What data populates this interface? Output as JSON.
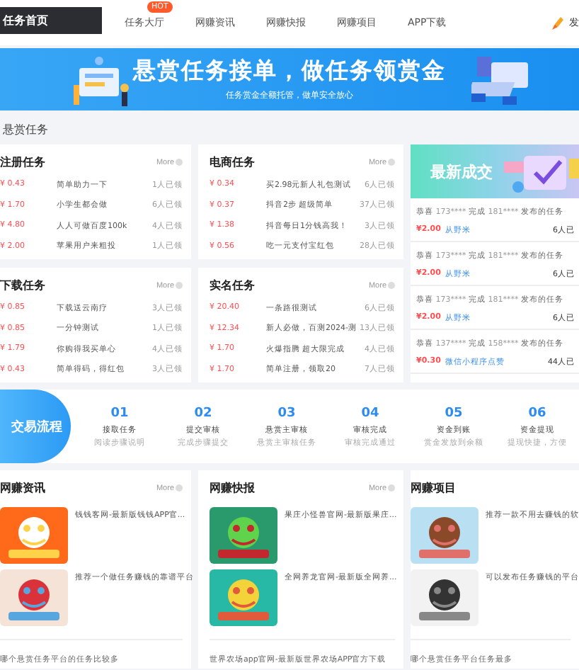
{
  "header": {
    "logo": "任务首页",
    "nav": [
      {
        "label": "任务大厅",
        "badge": "HOT",
        "selected": false
      },
      {
        "label": "网赚资讯",
        "selected": false
      },
      {
        "label": "网赚快报",
        "selected": false
      },
      {
        "label": "网赚项目",
        "selected": false
      },
      {
        "label": "APP下载",
        "selected": false
      }
    ],
    "right_text": "发"
  },
  "banner": {
    "title": "悬赏任务接单，做任务领赏金",
    "subtitle": "任务赏金全额托管，做单安全放心"
  },
  "section_title": "悬赏任务",
  "task_cards": [
    {
      "title": "注册任务",
      "more": "More",
      "rows": [
        {
          "price": "¥ 0.43",
          "name": "简单助力一下",
          "count": "1人已领"
        },
        {
          "price": "¥ 1.70",
          "name": "小学生都会做",
          "count": "6人已领"
        },
        {
          "price": "¥ 4.80",
          "name": "人人可做百度100k",
          "count": "4人已领"
        },
        {
          "price": "¥ 2.00",
          "name": "苹果用户来粗投",
          "count": "1人已领"
        }
      ]
    },
    {
      "title": "电商任务",
      "more": "More",
      "rows": [
        {
          "price": "¥ 0.34",
          "name": "买2.98元新人礼包测试",
          "count": "6人已领"
        },
        {
          "price": "¥ 0.37",
          "name": "抖音2步 超级简单",
          "count": "37人已领"
        },
        {
          "price": "¥ 1.38",
          "name": "抖音每日1分钱高我！",
          "count": "3人已领"
        },
        {
          "price": "¥ 0.56",
          "name": "吃一元支付宝红包",
          "count": "28人已领"
        }
      ]
    },
    {
      "title": "下载任务",
      "more": "More",
      "rows": [
        {
          "price": "¥ 0.85",
          "name": "下载送云南疗",
          "count": "3人已领"
        },
        {
          "price": "¥ 0.85",
          "name": "一分钟测试",
          "count": "1人已领"
        },
        {
          "price": "¥ 1.79",
          "name": "你购得我买单心",
          "count": "4人已领"
        },
        {
          "price": "¥ 0.43",
          "name": "简单得码，得红包",
          "count": "3人已领"
        }
      ]
    },
    {
      "title": "实名任务",
      "more": "More",
      "rows": [
        {
          "price": "¥ 20.40",
          "name": "一条路很测试",
          "count": "6人已领"
        },
        {
          "price": "¥ 12.34",
          "name": "新人必做，百测2024-测",
          "count": "13人已领"
        },
        {
          "price": "¥ 1.70",
          "name": "火爆指腾 超大限完成",
          "count": "4人已领"
        },
        {
          "price": "¥ 1.70",
          "name": "简单注册，领取20",
          "count": "7人已领"
        }
      ]
    }
  ],
  "deals": {
    "title": "最新成交",
    "items": [
      {
        "prefix": "恭喜",
        "user": "173****",
        "verb": "完成",
        "owner": "181****",
        "suffix": "发布的任务",
        "amount": "¥2.00",
        "task": "从野米",
        "earned": "6人已"
      },
      {
        "prefix": "恭喜",
        "user": "173****",
        "verb": "完成",
        "owner": "181****",
        "suffix": "发布的任务",
        "amount": "¥2.00",
        "task": "从野米",
        "earned": "6人已"
      },
      {
        "prefix": "恭喜",
        "user": "173****",
        "verb": "完成",
        "owner": "181****",
        "suffix": "发布的任务",
        "amount": "¥2.00",
        "task": "从野米",
        "earned": "6人已"
      },
      {
        "prefix": "恭喜",
        "user": "137****",
        "verb": "完成",
        "owner": "158****",
        "suffix": "发布的任务",
        "amount": "¥0.30",
        "task": "微信小程序点赞",
        "earned": "44人已"
      }
    ]
  },
  "process": {
    "title": "交易流程",
    "steps": [
      {
        "number": "01",
        "label": "接取任务",
        "note": "阅读步骤说明"
      },
      {
        "number": "02",
        "label": "提交审核",
        "note": "完成步骤提交"
      },
      {
        "number": "03",
        "label": "悬赏主审核",
        "note": "悬赏主审核任务"
      },
      {
        "number": "04",
        "label": "审核完成",
        "note": "审核完成通过"
      },
      {
        "number": "05",
        "label": "资金到账",
        "note": "赏金发放到余额"
      },
      {
        "number": "06",
        "label": "资金提现",
        "note": "提现快捷，方便"
      }
    ]
  },
  "news_cards": [
    {
      "title": "网赚资讯",
      "more": "More",
      "items": [
        {
          "text": "钱钱客网-最新版钱钱APP官..."
        },
        {
          "text": "推荐一个做任务赚钱的靠谱平台"
        }
      ],
      "footer": "哪个悬赏任务平台的任务比较多"
    },
    {
      "title": "网赚快报",
      "more": "More",
      "items": [
        {
          "text": "果庄小怪兽官网-最新版果庄..."
        },
        {
          "text": "全网养龙官网-最新版全网养..."
        }
      ],
      "footer": "世界农场app官网-最新版世界农场APP官方下载"
    },
    {
      "title": "网赚项目",
      "items": [
        {
          "text": "推荐一款不用去赚钱的软"
        },
        {
          "text": "可以发布任务赚钱的平台"
        }
      ],
      "footer": "哪个悬赏任务平台任务最多"
    }
  ]
}
